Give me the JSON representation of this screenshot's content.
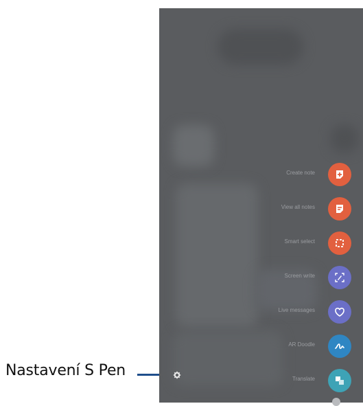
{
  "callout": {
    "label": "Nastavení S Pen"
  },
  "air_command": {
    "items": [
      {
        "label": "Create note",
        "icon": "create-note-icon",
        "color": "#e2603f"
      },
      {
        "label": "View all notes",
        "icon": "view-notes-icon",
        "color": "#e2603f"
      },
      {
        "label": "Smart select",
        "icon": "smart-select-icon",
        "color": "#e2603f"
      },
      {
        "label": "Screen write",
        "icon": "screen-write-icon",
        "color": "#6b6fc7"
      },
      {
        "label": "Live messages",
        "icon": "live-messages-icon",
        "color": "#6b6fc7"
      },
      {
        "label": "AR Doodle",
        "icon": "ar-doodle-icon",
        "color": "#2f86c3"
      },
      {
        "label": "Translate",
        "icon": "translate-icon",
        "color": "#3ea3b6"
      }
    ]
  },
  "colors": {
    "overlay": "#5a5c5f",
    "callout_line": "#1f4e8c"
  }
}
